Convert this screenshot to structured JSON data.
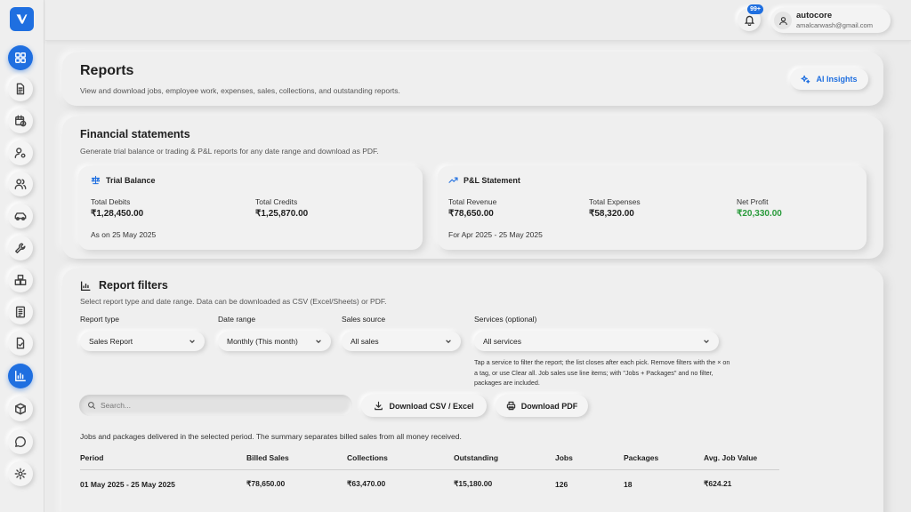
{
  "header": {
    "notification_count": "99+",
    "user_name": "autocore",
    "user_email": "amalcarwash@gmail.com"
  },
  "reports": {
    "title": "Reports",
    "subtitle": "View and download jobs, employee work, expenses, sales, collections, and outstanding reports.",
    "ai_insights_label": "AI Insights"
  },
  "financial": {
    "title": "Financial statements",
    "subtitle": "Generate trial balance or trading & P&L reports for any date range and download as PDF.",
    "trial_balance": {
      "title": "Trial Balance",
      "total_debits_label": "Total Debits",
      "total_debits": "₹1,28,450.00",
      "total_credits_label": "Total Credits",
      "total_credits": "₹1,25,870.00",
      "as_on": "As on 25 May 2025"
    },
    "pl": {
      "title": "P&L Statement",
      "total_revenue_label": "Total Revenue",
      "total_revenue": "₹78,650.00",
      "total_expenses_label": "Total Expenses",
      "total_expenses": "₹58,320.00",
      "net_profit_label": "Net Profit",
      "net_profit": "₹20,330.00",
      "period": "For Apr 2025 - 25 May 2025",
      "net_profit_color": "#2a9b3c"
    }
  },
  "filters": {
    "title": "Report filters",
    "subtitle": "Select report type and date range. Data can be downloaded as CSV (Excel/Sheets) or PDF.",
    "report_type_label": "Report type",
    "report_type_value": "Sales Report",
    "date_range_label": "Date range",
    "date_range_value": "Monthly (This month)",
    "sales_source_label": "Sales source",
    "sales_source_value": "All sales",
    "services_label": "Services (optional)",
    "services_value": "All services",
    "services_help": "Tap a service to filter the report; the list closes after each pick. Remove filters with the × on a tag, or use Clear all. Job sales use line items; with \"Jobs + Packages\" and no filter, packages are included.",
    "search_placeholder": "Search...",
    "download_csv_label": "Download CSV / Excel",
    "download_pdf_label": "Download PDF",
    "description": "Jobs and packages delivered in the selected period. The summary separates billed sales from all money received."
  },
  "table": {
    "columns": [
      "Period",
      "Billed Sales",
      "Collections",
      "Outstanding",
      "Jobs",
      "Packages",
      "Avg. Job Value"
    ],
    "rows": [
      [
        "01 May 2025 - 25 May 2025",
        "₹78,650.00",
        "₹63,470.00",
        "₹15,180.00",
        "126",
        "18",
        "₹624.21"
      ]
    ]
  },
  "sidebar": {
    "icons": [
      "dashboard-icon",
      "document-icon",
      "calendar-clock-icon",
      "user-settings-icon",
      "users-icon",
      "car-icon",
      "wrench-icon",
      "boxes-icon",
      "invoice-icon",
      "file-check-icon",
      "bar-chart-icon",
      "package-icon",
      "chat-icon",
      "settings-icon"
    ],
    "active": "bar-chart-icon",
    "accent": "#1f6fe0"
  }
}
